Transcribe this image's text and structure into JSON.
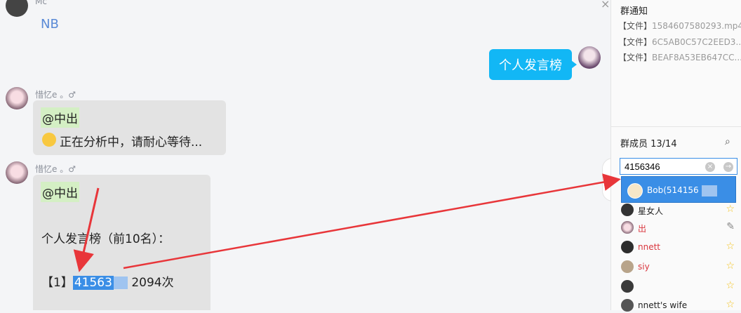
{
  "chat": {
    "close_glyph": "×",
    "messages": [
      {
        "sender": "Mc",
        "text": "NB"
      },
      {
        "self_text": "个人发言榜"
      },
      {
        "sender": "惜忆e 。♂",
        "mention": "@中出",
        "line2": "正在分析中，请耐心等待..."
      },
      {
        "sender": "惜忆e 。♂",
        "mention": "@中出",
        "line2": "个人发言榜（前10名）：",
        "rank_prefix": "【1】",
        "rank_id": "41563",
        "rank_suffix": " 2094次"
      }
    ]
  },
  "sidebar": {
    "notice_title": "群通知",
    "files": [
      {
        "tag": "【文件】",
        "name": "1584607580293.mp4"
      },
      {
        "tag": "【文件】",
        "name": "6C5AB0C57C2EED3..."
      },
      {
        "tag": "【文件】",
        "name": "BEAF8A53EB647CC..."
      }
    ],
    "members_title": "群成员 13/14",
    "search_value": "4156346",
    "suggestion": "Bob(514156",
    "members": [
      {
        "name": "星女人",
        "color": "#222",
        "mark": "☆"
      },
      {
        "name": "出",
        "color": "#d9363e",
        "mark": "✎"
      },
      {
        "name": "nnett",
        "color": "#d9363e",
        "mark": "☆"
      },
      {
        "name": "siy",
        "color": "#d9363e",
        "mark": "☆"
      },
      {
        "name": "",
        "color": "#222",
        "mark": "☆"
      },
      {
        "name": "nnett's wife",
        "color": "#222",
        "mark": "☆"
      }
    ]
  },
  "colors": {
    "accent": "#3a8ee6",
    "self_bubble": "#12b7f5",
    "arrow": "#e8363a"
  }
}
